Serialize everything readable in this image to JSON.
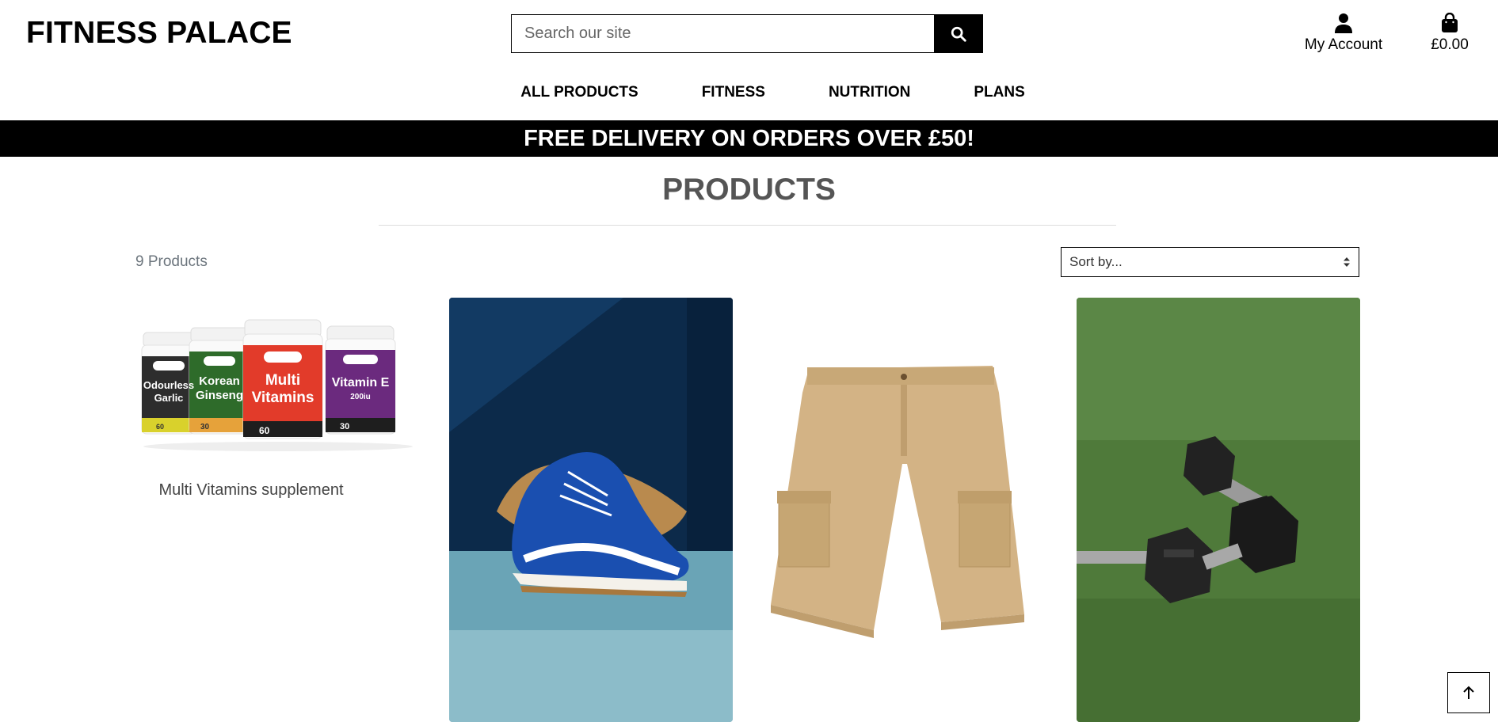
{
  "header": {
    "logo": "FITNESS PALACE",
    "search_placeholder": "Search our site",
    "account_label": "My Account",
    "bag_total": "£0.00"
  },
  "nav": {
    "items": [
      {
        "label": "ALL PRODUCTS"
      },
      {
        "label": "FITNESS"
      },
      {
        "label": "NUTRITION"
      },
      {
        "label": "PLANS"
      }
    ]
  },
  "banner": {
    "text": "FREE DELIVERY ON ORDERS OVER £50!"
  },
  "page": {
    "title": "PRODUCTS",
    "product_count": "9 Products",
    "sort_selected": "Sort by..."
  },
  "products": [
    {
      "name": "Multi Vitamins supplement",
      "image": "vitamin-bottles"
    },
    {
      "name": "",
      "image": "blue-sneaker"
    },
    {
      "name": "",
      "image": "cargo-shorts"
    },
    {
      "name": "",
      "image": "dumbbells"
    }
  ],
  "vitamins": [
    {
      "line1": "Odourless",
      "line2": "Garlic",
      "count": "60"
    },
    {
      "line1": "Korean",
      "line2": "Ginseng",
      "count": "30"
    },
    {
      "line1": "Multi",
      "line2": "Vitamins",
      "count": "60"
    },
    {
      "line1": "Vitamin E",
      "line2": "200iu",
      "count": "30"
    }
  ],
  "colors": {
    "accent": "#000000",
    "banner_text": "#ffffff",
    "title": "#555555",
    "muted": "#6c757d"
  }
}
